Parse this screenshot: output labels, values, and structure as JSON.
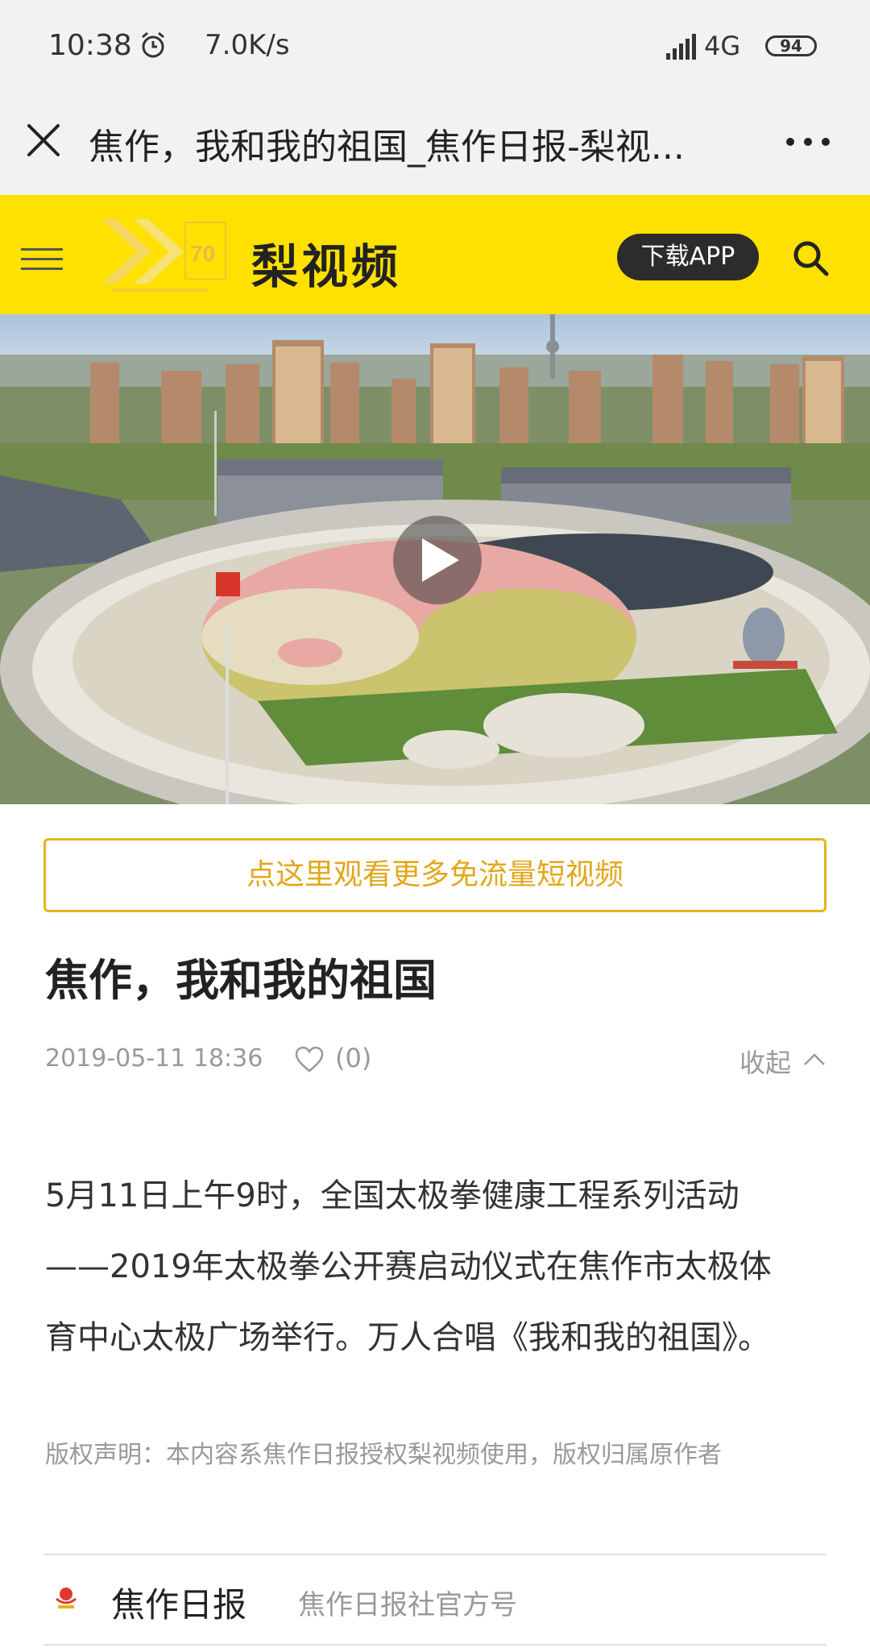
{
  "status_bar": {
    "time": "10:38",
    "speed": "7.0K/s",
    "network": "4G",
    "battery": "94",
    "icons": [
      "alarm-icon",
      "signal-icon",
      "battery-icon"
    ]
  },
  "nav_bar": {
    "title": "焦作，我和我的祖国_焦作日报-梨视...",
    "icons": [
      "close-icon",
      "more-icon"
    ]
  },
  "site_header": {
    "brand": "梨视频",
    "download_label": "下载APP",
    "accent_color": "#ffe100",
    "icons": [
      "menu-icon",
      "search-icon"
    ]
  },
  "video": {
    "icons": [
      "play-icon"
    ]
  },
  "promo": {
    "label": "点这里观看更多免流量短视频",
    "color": "#e3a71a"
  },
  "article": {
    "title": "焦作，我和我的祖国",
    "date": "2019-05-11 18:36",
    "likes": "(0)",
    "collapse_label": "收起",
    "body_lines": [
      "5月11日上午9时，全国太极拳健康工程系列活动",
      "——2019年太极拳公开赛启动仪式在焦作市太极体",
      "育中心太极广场举行。万人合唱《我和我的祖国》。"
    ],
    "copyright": "版权声明：本内容系焦作日报授权梨视频使用，版权归属原作者"
  },
  "source": {
    "name": "焦作日报",
    "description": "焦作日报社官方号"
  }
}
